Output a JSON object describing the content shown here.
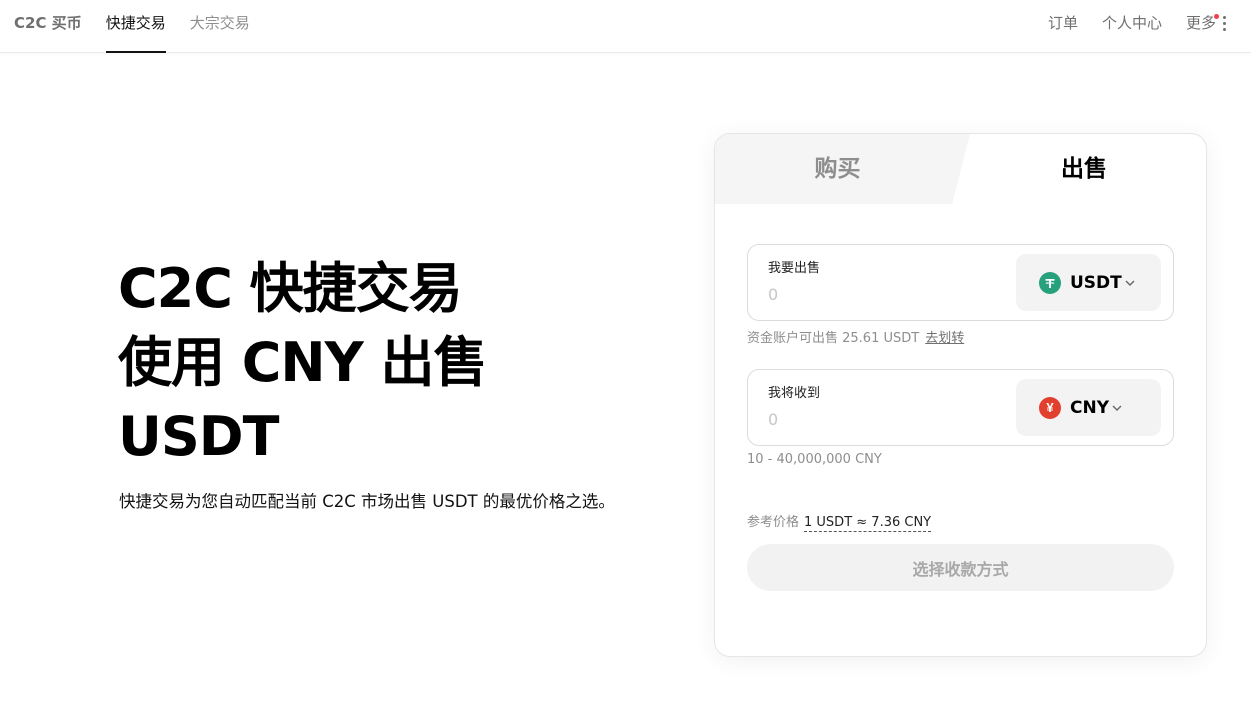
{
  "nav": {
    "brand": "C2C 买币",
    "items": [
      "快捷交易",
      "大宗交易"
    ],
    "right": {
      "orders": "订单",
      "profile": "个人中心",
      "more": "更多"
    }
  },
  "hero": {
    "title_lines": [
      "C2C 快捷交易",
      "使用 CNY 出售",
      "USDT"
    ],
    "description": "快捷交易为您自动匹配当前 C2C 市场出售 USDT 的最优价格之选。"
  },
  "card": {
    "tabs": {
      "buy": "购买",
      "sell": "出售"
    },
    "sell_field": {
      "label": "我要出售",
      "placeholder": "0",
      "currency": "USDT",
      "coin_icon": "tether-icon"
    },
    "available": {
      "text": "资金账户可出售 25.61 USDT",
      "transfer_link": "去划转"
    },
    "receive_field": {
      "label": "我将收到",
      "placeholder": "0",
      "currency": "CNY",
      "coin_icon": "yuan-icon"
    },
    "limit_text": "10 - 40,000,000 CNY",
    "reference": {
      "label": "参考价格",
      "value": "1 USDT ≈ 7.36 CNY"
    },
    "submit_label": "选择收款方式"
  },
  "colors": {
    "usdt": "#26a17b",
    "cny": "#e2402f",
    "notice_dot": "#ef3f4a"
  }
}
